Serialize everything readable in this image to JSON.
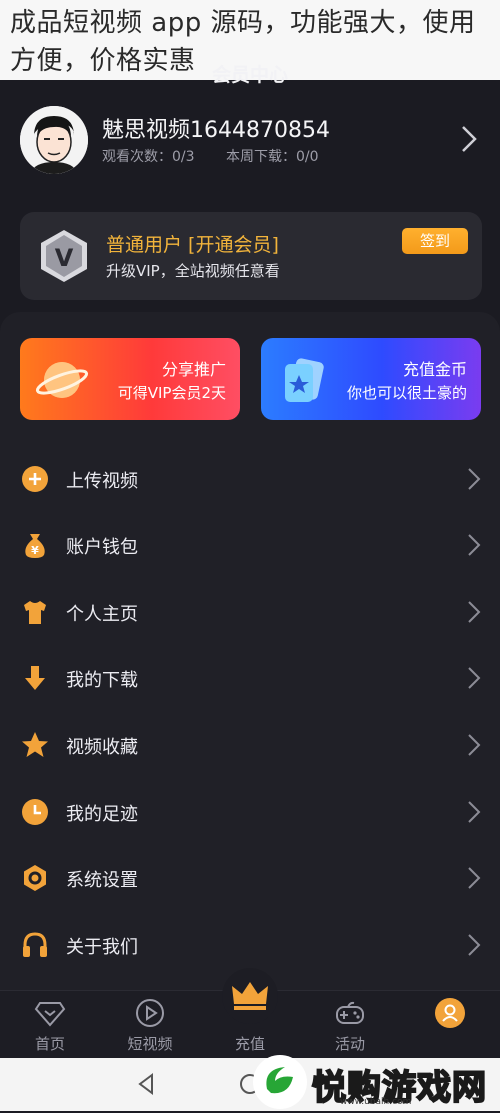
{
  "overlay": {
    "caption": "成品短视频 app 源码，功能强大，使用方便，价格实惠"
  },
  "header": {
    "title": "会员中心"
  },
  "profile": {
    "username": "魅思视频1644870854",
    "watch_stat": "观看次数：0/3",
    "download_stat": "本周下载：0/0"
  },
  "vip": {
    "title": "普通用户 [开通会员]",
    "subtitle": "升级VIP，全站视频任意看",
    "checkin_label": "签到"
  },
  "promos": [
    {
      "title": "分享推广",
      "subtitle": "可得VIP会员2天"
    },
    {
      "title": "充值金币",
      "subtitle": "你也可以很土豪的"
    }
  ],
  "menu": [
    {
      "label": "上传视频",
      "icon": "plus-circle-icon"
    },
    {
      "label": "账户钱包",
      "icon": "money-bag-icon"
    },
    {
      "label": "个人主页",
      "icon": "shirt-icon"
    },
    {
      "label": "我的下载",
      "icon": "download-arrow-icon"
    },
    {
      "label": "视频收藏",
      "icon": "star-icon"
    },
    {
      "label": "我的足迹",
      "icon": "clock-icon"
    },
    {
      "label": "系统设置",
      "icon": "settings-hexagon-icon"
    },
    {
      "label": "关于我们",
      "icon": "headset-icon"
    }
  ],
  "tabbar": [
    {
      "label": "首页",
      "icon": "home-diamond-icon"
    },
    {
      "label": "短视频",
      "icon": "play-circle-icon"
    },
    {
      "label": "充值",
      "icon": "crown-icon"
    },
    {
      "label": "活动",
      "icon": "gamepad-icon"
    }
  ],
  "watermark": {
    "text": "悦购游戏网",
    "domain": "www.ubalh.com"
  },
  "colors": {
    "accent": "#f2a33a",
    "background": "#1b1b22",
    "panel": "#202027"
  }
}
